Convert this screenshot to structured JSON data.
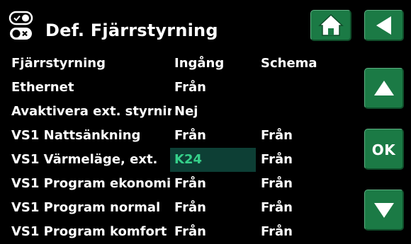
{
  "header": {
    "title": "Def. Fjärrstyrning",
    "icon": "remote-toggle-icon"
  },
  "nav": {
    "home_icon": "home-icon",
    "back_icon": "back-arrow-icon",
    "up_icon": "up-arrow-icon",
    "down_icon": "down-arrow-icon",
    "ok_label": "OK"
  },
  "colors": {
    "button_green": "#1b7a45",
    "selected_bg": "#0d3f35",
    "selected_text": "#35d08a"
  },
  "table": {
    "rows": [
      {
        "label": "Fjärrstyrning",
        "input": "Ingång",
        "schedule": "Schema"
      },
      {
        "label": "Ethernet",
        "input": "Från",
        "schedule": ""
      },
      {
        "label": "Avaktivera ext. styrning",
        "input": "Nej",
        "schedule": ""
      },
      {
        "label": "VS1 Nattsänkning",
        "input": "Från",
        "schedule": "Från"
      },
      {
        "label": "VS1 Värmeläge, ext.",
        "input": "K24",
        "schedule": "Från",
        "selected": true
      },
      {
        "label": "VS1 Program ekonomi",
        "input": "Från",
        "schedule": "Från"
      },
      {
        "label": "VS1 Program normal",
        "input": "Från",
        "schedule": "Från"
      },
      {
        "label": "VS1 Program komfort",
        "input": "Från",
        "schedule": "Från"
      }
    ]
  }
}
